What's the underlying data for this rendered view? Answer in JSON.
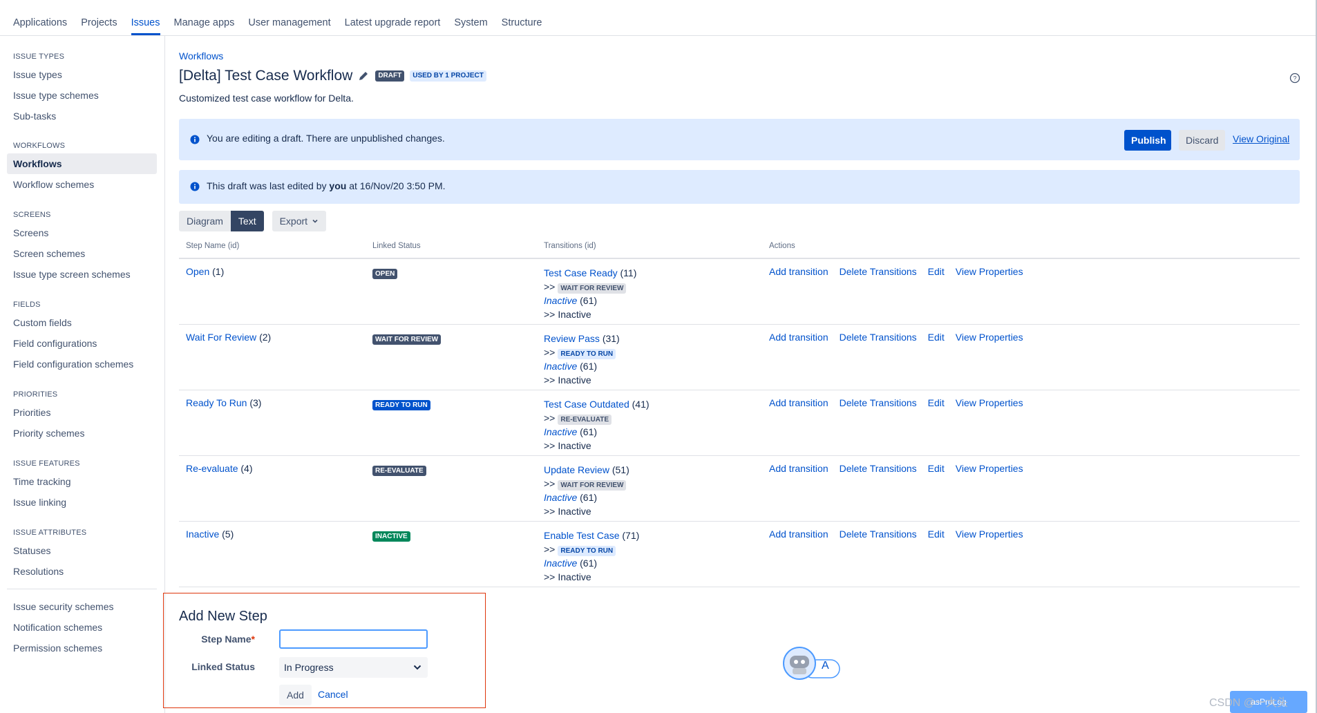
{
  "topnav": {
    "tabs": [
      {
        "label": "Applications"
      },
      {
        "label": "Projects"
      },
      {
        "label": "Issues"
      },
      {
        "label": "Manage apps"
      },
      {
        "label": "User management"
      },
      {
        "label": "Latest upgrade report"
      },
      {
        "label": "System"
      },
      {
        "label": "Structure"
      }
    ],
    "active_tab": "Issues"
  },
  "sidebar": {
    "sections": [
      {
        "title": "ISSUE TYPES",
        "items": [
          "Issue types",
          "Issue type schemes",
          "Sub-tasks"
        ]
      },
      {
        "title": "WORKFLOWS",
        "items": [
          "Workflows",
          "Workflow schemes"
        ]
      },
      {
        "title": "SCREENS",
        "items": [
          "Screens",
          "Screen schemes",
          "Issue type screen schemes"
        ]
      },
      {
        "title": "FIELDS",
        "items": [
          "Custom fields",
          "Field configurations",
          "Field configuration schemes"
        ]
      },
      {
        "title": "PRIORITIES",
        "items": [
          "Priorities",
          "Priority schemes"
        ]
      },
      {
        "title": "ISSUE FEATURES",
        "items": [
          "Time tracking",
          "Issue linking"
        ]
      },
      {
        "title": "ISSUE ATTRIBUTES",
        "items": [
          "Statuses",
          "Resolutions"
        ]
      },
      {
        "title": "",
        "items": [
          "Issue security schemes",
          "Notification schemes",
          "Permission schemes"
        ]
      }
    ],
    "active_item": "Workflows"
  },
  "main": {
    "breadcrumb": "Workflows",
    "title": "[Delta] Test Case Workflow",
    "draft_badge": "DRAFT",
    "used_badge": "USED BY 1 PROJECT",
    "description": "Customized test case workflow for Delta.",
    "draft_banner": {
      "message": "You are editing a draft. There are unpublished changes.",
      "publish_label": "Publish",
      "discard_label": "Discard",
      "view_original_label": "View Original"
    },
    "edited_banner": {
      "prefix": "This draft was last edited by",
      "user": "you",
      "suffix": "at 16/Nov/20 3:50 PM."
    },
    "view_toggle": {
      "diagram": "Diagram",
      "text": "Text",
      "export": "Export"
    },
    "table": {
      "headers": {
        "step": "Step Name (id)",
        "status": "Linked Status",
        "transitions": "Transitions (id)",
        "actions": "Actions"
      },
      "action_labels": {
        "add": "Add transition",
        "delete": "Delete Transitions",
        "edit": "Edit",
        "props": "View Properties"
      },
      "rows": [
        {
          "name": "Open",
          "id": "(1)",
          "status": "OPEN",
          "t1_name": "Test Case Ready",
          "t1_id": "(11)",
          "t1_target": "WAIT FOR REVIEW",
          "t2_name": "Inactive",
          "t2_id": "(61)",
          "t2_target": "Inactive"
        },
        {
          "name": "Wait For Review",
          "id": "(2)",
          "status": "WAIT FOR REVIEW",
          "t1_name": "Review Pass",
          "t1_id": "(31)",
          "t1_target": "READY TO RUN",
          "t2_name": "Inactive",
          "t2_id": "(61)",
          "t2_target": "Inactive"
        },
        {
          "name": "Ready To Run",
          "id": "(3)",
          "status": "READY TO RUN",
          "t1_name": "Test Case Outdated",
          "t1_id": "(41)",
          "t1_target": "RE-EVALUATE",
          "t2_name": "Inactive",
          "t2_id": "(61)",
          "t2_target": "Inactive"
        },
        {
          "name": "Re-evaluate",
          "id": "(4)",
          "status": "RE-EVALUATE",
          "t1_name": "Update Review",
          "t1_id": "(51)",
          "t1_target": "WAIT FOR REVIEW",
          "t2_name": "Inactive",
          "t2_id": "(61)",
          "t2_target": "Inactive"
        },
        {
          "name": "Inactive",
          "id": "(5)",
          "status": "INACTIVE",
          "t1_name": "Enable Test Case",
          "t1_id": "(71)",
          "t1_target": "READY TO RUN",
          "t2_name": "Inactive",
          "t2_id": "(61)",
          "t2_target": "Inactive"
        }
      ]
    },
    "add_step": {
      "heading": "Add New Step",
      "step_name_label": "Step Name",
      "required_mark": "*",
      "step_name_value": "",
      "linked_status_label": "Linked Status",
      "linked_status_value": "In Progress",
      "add_label": "Add",
      "cancel_label": "Cancel"
    }
  },
  "overlay": {
    "assistant_badge": "A",
    "watermark": "CSDN @一大头",
    "mini_tool": "asProLog"
  },
  "colors": {
    "accent": "#0052cc",
    "banner_bg": "#deebff",
    "status_grey": "#42526e",
    "status_blue": "#0052cc",
    "status_green": "#00875a",
    "highlight_border": "#de350b"
  }
}
